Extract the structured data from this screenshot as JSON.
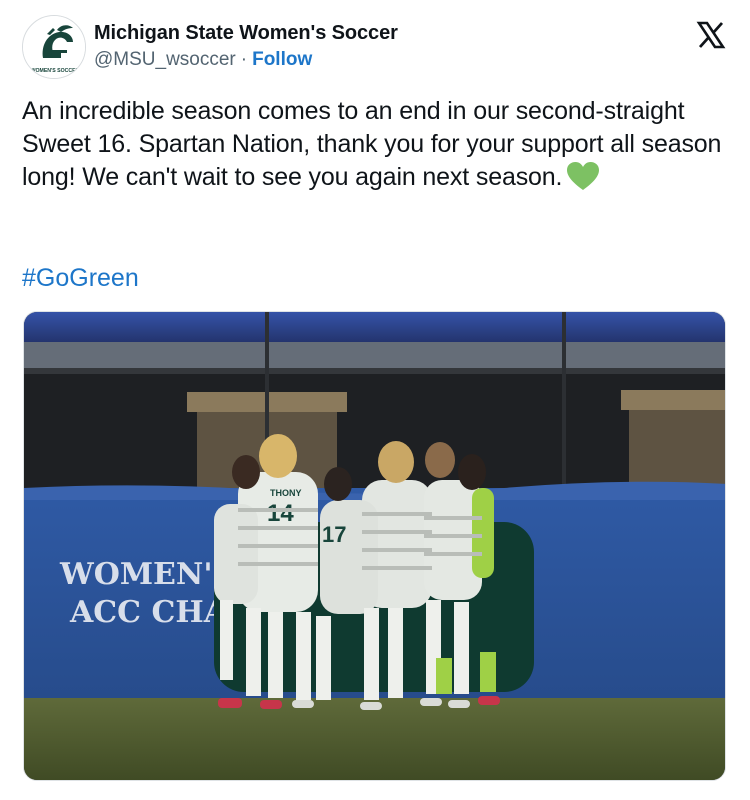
{
  "author": {
    "display_name": "Michigan State Women's Soccer",
    "handle": "@MSU_wsoccer",
    "separator": "·",
    "follow_label": "Follow",
    "avatar_caption": "WOMEN'S SOCCER"
  },
  "post": {
    "text": "An incredible season comes to an end in our second-straight Sweet 16. Spartan Nation, thank you for your support all season long! We can't wait to see you again next season.",
    "emoji": "green-heart",
    "hashtag": "#GoGreen"
  },
  "photo": {
    "banner_line1": "WOMEN'S",
    "banner_line2": "ACC CHA",
    "jersey_name": "THONY",
    "jersey_number": "14",
    "jersey_number_2": "17"
  },
  "icons": {
    "platform": "x-logo-icon",
    "emoji": "green-heart-icon"
  },
  "colors": {
    "link": "#1d76c9",
    "text": "#0f1419",
    "muted": "#536471",
    "heart": "#7dc163",
    "msu_green": "#18453b",
    "banner_blue": "#2f5aa5"
  }
}
